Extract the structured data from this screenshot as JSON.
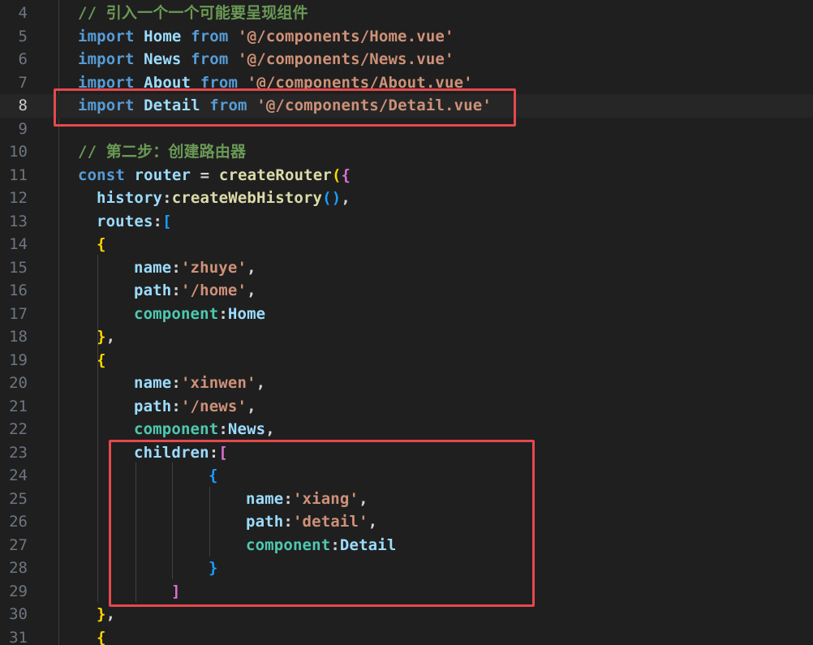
{
  "editor": {
    "active_line": 8,
    "lines": [
      {
        "n": "4",
        "indent": 0,
        "tokens": [
          [
            "tok-comment",
            "// 引入一个一个可能要呈现组件"
          ]
        ]
      },
      {
        "n": "5",
        "indent": 0,
        "tokens": [
          [
            "tok-kw",
            "import"
          ],
          [
            "tok-plain",
            " "
          ],
          [
            "tok-var",
            "Home"
          ],
          [
            "tok-plain",
            " "
          ],
          [
            "tok-kw",
            "from"
          ],
          [
            "tok-plain",
            " "
          ],
          [
            "tok-str",
            "'@/components/Home.vue'"
          ]
        ]
      },
      {
        "n": "6",
        "indent": 0,
        "tokens": [
          [
            "tok-kw",
            "import"
          ],
          [
            "tok-plain",
            " "
          ],
          [
            "tok-var",
            "News"
          ],
          [
            "tok-plain",
            " "
          ],
          [
            "tok-kw",
            "from"
          ],
          [
            "tok-plain",
            " "
          ],
          [
            "tok-str",
            "'@/components/News.vue'"
          ]
        ]
      },
      {
        "n": "7",
        "indent": 0,
        "tokens": [
          [
            "tok-kw",
            "import"
          ],
          [
            "tok-plain",
            " "
          ],
          [
            "tok-var",
            "About"
          ],
          [
            "tok-plain",
            " "
          ],
          [
            "tok-kw",
            "from"
          ],
          [
            "tok-plain",
            " "
          ],
          [
            "tok-str",
            "'@/components/About.vue'"
          ]
        ]
      },
      {
        "n": "8",
        "indent": 0,
        "tokens": [
          [
            "tok-kw",
            "import"
          ],
          [
            "tok-plain",
            " "
          ],
          [
            "tok-var",
            "Detail"
          ],
          [
            "tok-plain",
            " "
          ],
          [
            "tok-kw",
            "from"
          ],
          [
            "tok-plain",
            " "
          ],
          [
            "tok-str",
            "'@/components/Detail.vue'"
          ]
        ]
      },
      {
        "n": "9",
        "indent": 0,
        "tokens": []
      },
      {
        "n": "10",
        "indent": 0,
        "tokens": [
          [
            "tok-comment",
            "// 第二步：创建路由器"
          ]
        ]
      },
      {
        "n": "11",
        "indent": 0,
        "tokens": [
          [
            "tok-kw",
            "const"
          ],
          [
            "tok-plain",
            " "
          ],
          [
            "tok-var",
            "router"
          ],
          [
            "tok-plain",
            " = "
          ],
          [
            "tok-fn",
            "createRouter"
          ],
          [
            "tok-brace-y",
            "("
          ],
          [
            "tok-brace-p",
            "{"
          ]
        ]
      },
      {
        "n": "12",
        "indent": 1,
        "tokens": [
          [
            "tok-prop",
            "history"
          ],
          [
            "tok-plain",
            ":"
          ],
          [
            "tok-fn",
            "createWebHistory"
          ],
          [
            "tok-brace-b",
            "()"
          ],
          [
            "tok-plain",
            ","
          ]
        ]
      },
      {
        "n": "13",
        "indent": 1,
        "tokens": [
          [
            "tok-prop",
            "routes"
          ],
          [
            "tok-plain",
            ":"
          ],
          [
            "tok-brace-b",
            "["
          ]
        ]
      },
      {
        "n": "14",
        "indent": 1,
        "tokens": [
          [
            "tok-brace-y",
            "{"
          ]
        ]
      },
      {
        "n": "15",
        "indent": 3,
        "tokens": [
          [
            "tok-prop",
            "name"
          ],
          [
            "tok-plain",
            ":"
          ],
          [
            "tok-str",
            "'zhuye'"
          ],
          [
            "tok-plain",
            ","
          ]
        ]
      },
      {
        "n": "16",
        "indent": 3,
        "tokens": [
          [
            "tok-prop",
            "path"
          ],
          [
            "tok-plain",
            ":"
          ],
          [
            "tok-str",
            "'/home'"
          ],
          [
            "tok-plain",
            ","
          ]
        ]
      },
      {
        "n": "17",
        "indent": 3,
        "tokens": [
          [
            "tok-prop2",
            "component"
          ],
          [
            "tok-plain",
            ":"
          ],
          [
            "tok-ident",
            "Home"
          ]
        ]
      },
      {
        "n": "18",
        "indent": 1,
        "tokens": [
          [
            "tok-brace-y",
            "}"
          ],
          [
            "tok-plain",
            ","
          ]
        ]
      },
      {
        "n": "19",
        "indent": 1,
        "tokens": [
          [
            "tok-brace-y",
            "{"
          ]
        ]
      },
      {
        "n": "20",
        "indent": 3,
        "tokens": [
          [
            "tok-prop",
            "name"
          ],
          [
            "tok-plain",
            ":"
          ],
          [
            "tok-str",
            "'xinwen'"
          ],
          [
            "tok-plain",
            ","
          ]
        ]
      },
      {
        "n": "21",
        "indent": 3,
        "tokens": [
          [
            "tok-prop",
            "path"
          ],
          [
            "tok-plain",
            ":"
          ],
          [
            "tok-str",
            "'/news'"
          ],
          [
            "tok-plain",
            ","
          ]
        ]
      },
      {
        "n": "22",
        "indent": 3,
        "tokens": [
          [
            "tok-prop2",
            "component"
          ],
          [
            "tok-plain",
            ":"
          ],
          [
            "tok-ident",
            "News"
          ],
          [
            "tok-plain",
            ","
          ]
        ]
      },
      {
        "n": "23",
        "indent": 3,
        "tokens": [
          [
            "tok-prop",
            "children"
          ],
          [
            "tok-plain",
            ":"
          ],
          [
            "tok-brace-p",
            "["
          ]
        ]
      },
      {
        "n": "24",
        "indent": 7,
        "tokens": [
          [
            "tok-brace-b",
            "{"
          ]
        ]
      },
      {
        "n": "25",
        "indent": 9,
        "tokens": [
          [
            "tok-prop",
            "name"
          ],
          [
            "tok-plain",
            ":"
          ],
          [
            "tok-str",
            "'xiang'"
          ],
          [
            "tok-plain",
            ","
          ]
        ]
      },
      {
        "n": "26",
        "indent": 9,
        "tokens": [
          [
            "tok-prop",
            "path"
          ],
          [
            "tok-plain",
            ":"
          ],
          [
            "tok-str",
            "'detail'"
          ],
          [
            "tok-plain",
            ","
          ]
        ]
      },
      {
        "n": "27",
        "indent": 9,
        "tokens": [
          [
            "tok-prop2",
            "component"
          ],
          [
            "tok-plain",
            ":"
          ],
          [
            "tok-ident",
            "Detail"
          ]
        ]
      },
      {
        "n": "28",
        "indent": 7,
        "tokens": [
          [
            "tok-brace-b",
            "}"
          ]
        ]
      },
      {
        "n": "29",
        "indent": 5,
        "tokens": [
          [
            "tok-brace-p",
            "]"
          ]
        ]
      },
      {
        "n": "30",
        "indent": 1,
        "tokens": [
          [
            "tok-brace-y",
            "}"
          ],
          [
            "tok-plain",
            ","
          ]
        ]
      },
      {
        "n": "31",
        "indent": 1,
        "tokens": [
          [
            "tok-brace-y",
            "{"
          ]
        ]
      }
    ]
  },
  "colors": {
    "background": "#1f1f1f",
    "highlight_border": "#e5484d",
    "keyword": "#569cd6",
    "string": "#ce9178",
    "comment": "#6a9955",
    "function": "#dcdcaa"
  }
}
